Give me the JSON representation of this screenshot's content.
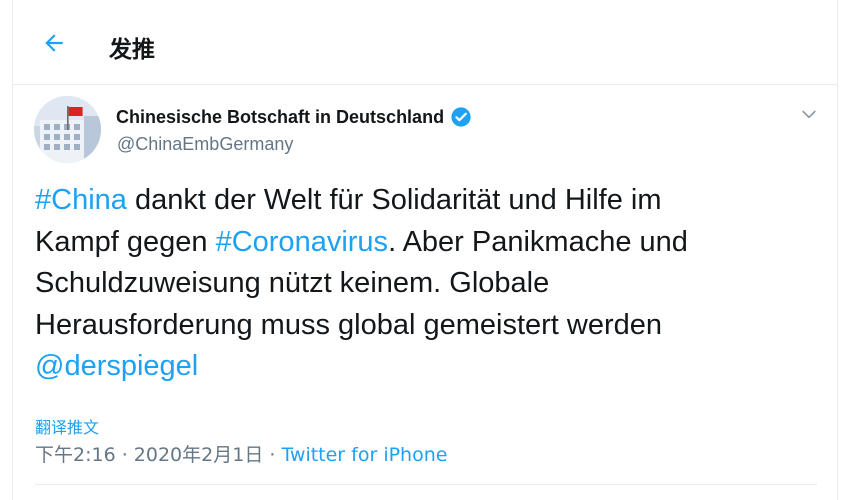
{
  "header": {
    "back_icon": "arrow-left-icon",
    "title": "发推"
  },
  "tweet": {
    "author": {
      "display_name": "Chinesische Botschaft in Deutschland",
      "handle": "@ChinaEmbGermany",
      "verified_icon": "verified-badge-icon"
    },
    "caret_icon": "chevron-down-icon",
    "text": {
      "line1": {
        "hashtag": "#China",
        "rest": " dankt der Welt für Solidarität und Hilfe im"
      },
      "line2": {
        "before": "Kampf gegen ",
        "hashtag": "#Coronavirus",
        "after": ". Aber Panikmache und"
      },
      "line3": "Schuldzuweisung nützt keinem. Globale",
      "line4": "Herausforderung muss global gemeistert werden",
      "mention": "@derspiegel"
    },
    "translate_label": "翻译推文",
    "timestamp": "下午2:16 · 2020年2月1日 · ",
    "source": "Twitter for iPhone"
  },
  "colors": {
    "accent": "#1da1f2",
    "text": "#14171a",
    "secondary": "#657786",
    "border": "#e6ecf0"
  }
}
